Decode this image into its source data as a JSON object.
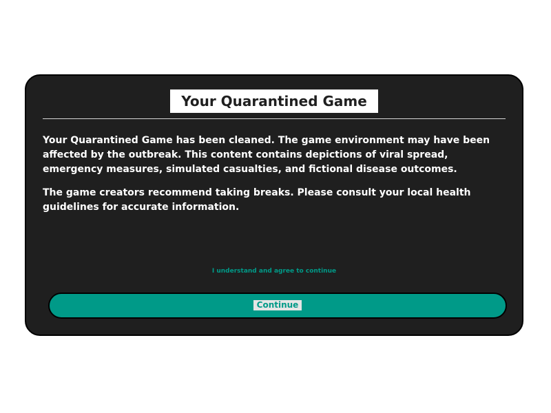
{
  "dialog": {
    "title": "Your Quarantined Game",
    "body_paragraphs": [
      "Your Quarantined Game has been cleaned. The game environment may have been affected by the outbreak. This content contains depictions of viral spread, emergency measures, simulated casualties, and fictional disease outcomes.",
      "The game creators recommend taking breaks. Please consult your local health guidelines for accurate information."
    ],
    "acknowledge_link": "I understand and agree to continue",
    "primary_button": "Continue"
  },
  "colors": {
    "dialog_bg": "#1f1f1f",
    "accent": "#009a88",
    "text": "#ffffff"
  }
}
